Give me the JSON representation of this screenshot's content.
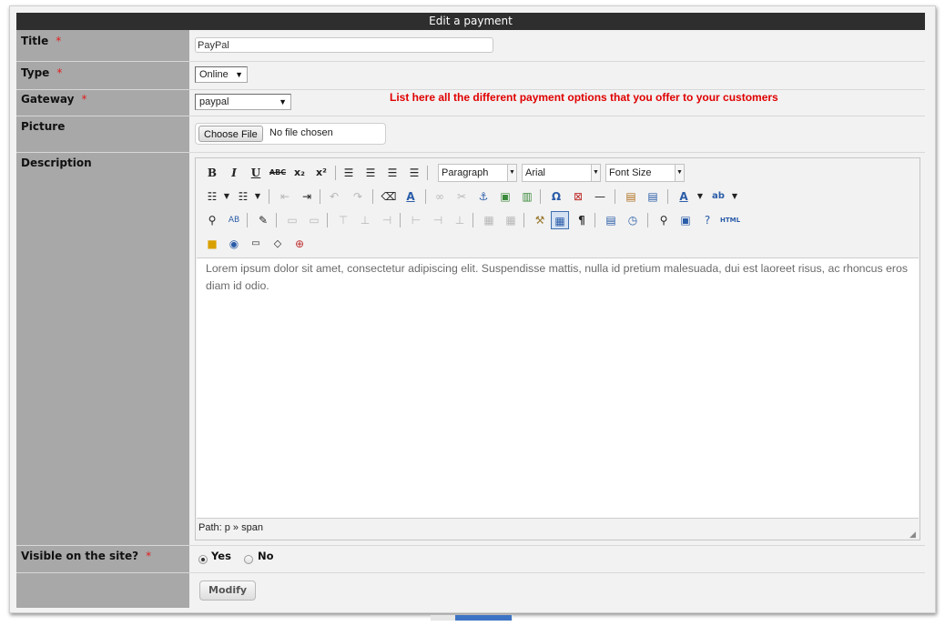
{
  "header": {
    "title": "Edit a payment"
  },
  "fields": {
    "title": {
      "label": "Title",
      "required": "*",
      "value": "PayPal"
    },
    "type": {
      "label": "Type",
      "required": "*",
      "value": "Online"
    },
    "gateway": {
      "label": "Gateway",
      "required": "*",
      "value": "paypal",
      "hint": "List here all the different payment options that you offer to your customers"
    },
    "picture": {
      "label": "Picture",
      "button": "Choose File",
      "status": "No file chosen"
    },
    "description": {
      "label": "Description",
      "format_select": "Paragraph",
      "font_select": "Arial",
      "size_select": "Font Size",
      "content": "Lorem ipsum dolor sit amet, consectetur adipiscing elit. Suspendisse mattis, nulla id pretium malesuada, dui est laoreet risus, ac rhoncus eros diam id odio.",
      "path": "Path: p » span"
    },
    "visible": {
      "label": "Visible on the site?",
      "required": "*",
      "options": [
        "Yes",
        "No"
      ],
      "selected": "Yes"
    }
  },
  "actions": {
    "modify_label": "Modify"
  },
  "colors": {
    "header_bg": "#2e2e2e",
    "label_bg": "#a8a8a8",
    "required": "#e02020",
    "hint": "#e00000"
  }
}
